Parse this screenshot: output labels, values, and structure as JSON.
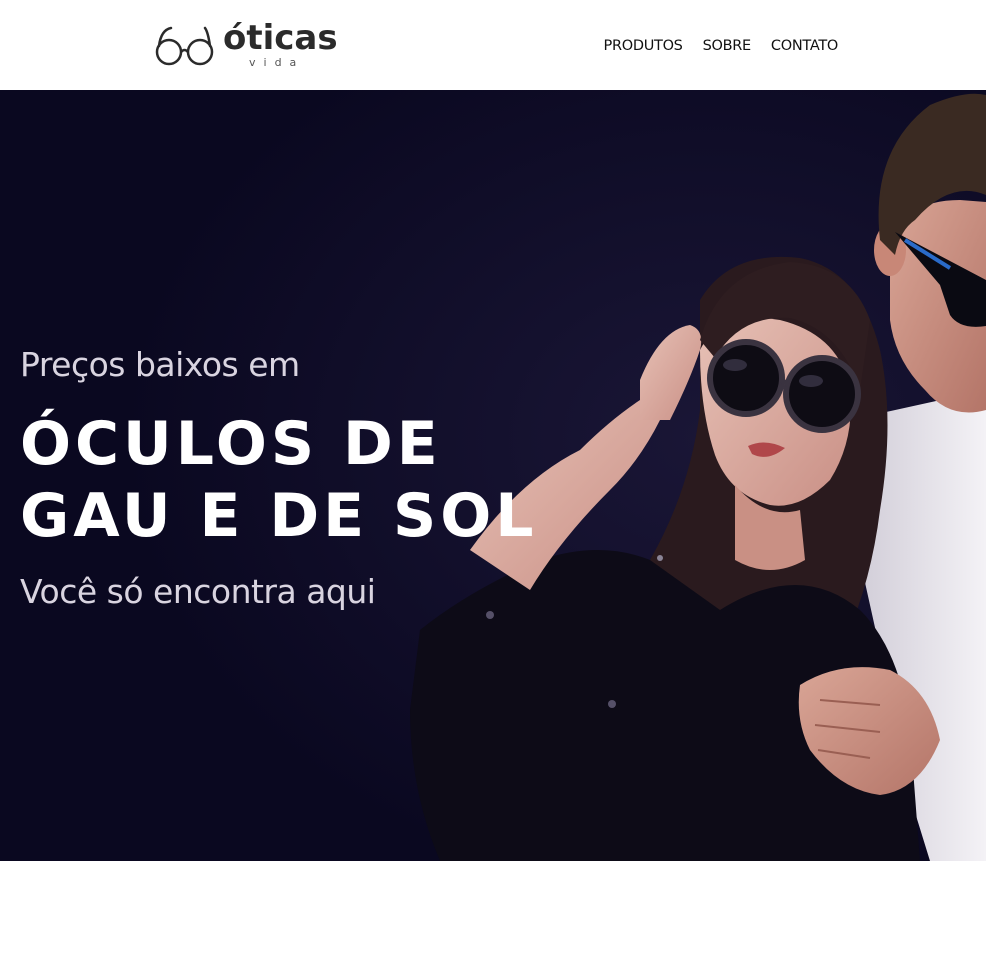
{
  "brand": {
    "name": "óticas",
    "subtitle": "vida",
    "icon": "glasses-icon"
  },
  "nav": {
    "items": [
      {
        "label": "PRODUTOS"
      },
      {
        "label": "SOBRE"
      },
      {
        "label": "CONTATO"
      }
    ]
  },
  "hero": {
    "pre_title": "Preços baixos em",
    "title_line1": "ÓCULOS DE",
    "title_line2": "GAU E DE SOL",
    "subtitle": "Você só encontra aqui",
    "background_color": "#0c0a24",
    "image": "couple-wearing-sunglasses-photo"
  },
  "colors": {
    "header_bg": "#ffffff",
    "hero_bg": "#0c0a24",
    "hero_text": "#ffffff",
    "hero_muted_text": "#d9d4e0"
  }
}
